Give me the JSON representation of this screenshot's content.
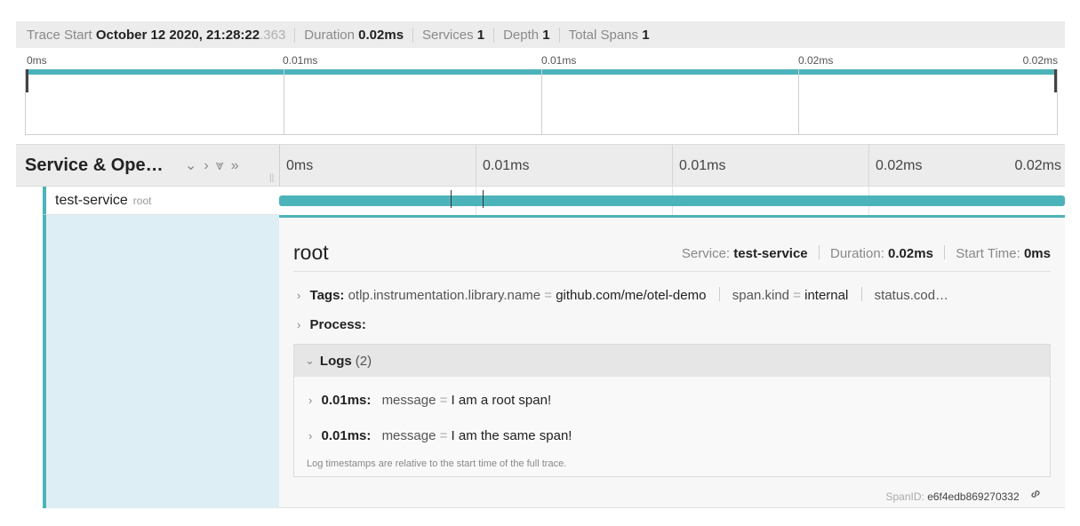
{
  "trace_header": {
    "start_label": "Trace Start",
    "start_value_bold": "October 12 2020, 21:28:22",
    "start_value_ms": ".363",
    "duration_label": "Duration",
    "duration_value": "0.02ms",
    "services_label": "Services",
    "services_value": "1",
    "depth_label": "Depth",
    "depth_value": "1",
    "spans_label": "Total Spans",
    "spans_value": "1"
  },
  "minimap": {
    "ticks": [
      "0ms",
      "0.01ms",
      "0.01ms",
      "0.02ms",
      "0.02ms"
    ]
  },
  "timeline_header": {
    "title": "Service & Ope…",
    "controls": [
      "chevron-down-icon",
      "chevron-right-icon",
      "double-chevron-down-icon",
      "double-chevron-right-icon"
    ],
    "ticks": [
      "0ms",
      "0.01ms",
      "0.01ms",
      "0.02ms",
      "0.02ms"
    ]
  },
  "span_row": {
    "service": "test-service",
    "operation": "root",
    "bar_color": "#4db3ba"
  },
  "detail": {
    "title": "root",
    "service_label": "Service:",
    "service_value": "test-service",
    "duration_label": "Duration:",
    "duration_value": "0.02ms",
    "start_label": "Start Time:",
    "start_value": "0ms",
    "tags_label": "Tags:",
    "tags": [
      {
        "key": "otlp.instrumentation.library.name",
        "value": "github.com/me/otel-demo"
      },
      {
        "key": "span.kind",
        "value": "internal"
      },
      {
        "key": "status.cod…",
        "value": ""
      }
    ],
    "process_label": "Process:",
    "logs_label": "Logs",
    "logs_count": "(2)",
    "logs": [
      {
        "time": "0.01ms:",
        "key": "message",
        "value": "I am a root span!"
      },
      {
        "time": "0.01ms:",
        "key": "message",
        "value": "I am the same span!"
      }
    ],
    "logs_note": "Log timestamps are relative to the start time of the full trace.",
    "span_id_label": "SpanID:",
    "span_id_value": "e6f4edb869270332"
  },
  "colors": {
    "accent": "#4db3ba",
    "gutter": "#ddeff5"
  }
}
